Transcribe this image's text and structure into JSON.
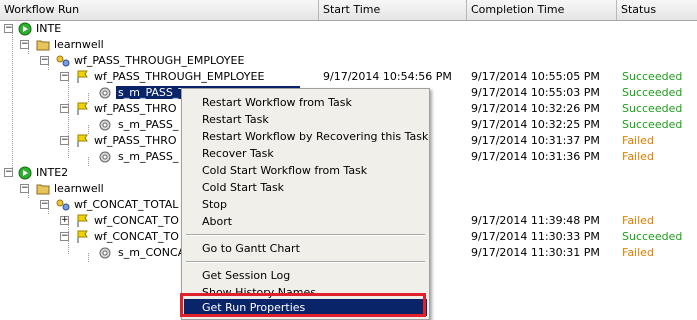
{
  "columns": [
    "Workflow Run",
    "Start Time",
    "Completion Time",
    "Status"
  ],
  "rows": [
    {
      "label": "INTE",
      "start": "",
      "end": "",
      "status": "",
      "statusType": ""
    },
    {
      "label": "learnwell",
      "start": "",
      "end": "",
      "status": "",
      "statusType": ""
    },
    {
      "label": "wf_PASS_THROUGH_EMPLOYEE",
      "start": "",
      "end": "",
      "status": "",
      "statusType": ""
    },
    {
      "label": "wf_PASS_THROUGH_EMPLOYEE",
      "start": "9/17/2014 10:54:56 PM",
      "end": "9/17/2014 10:55:05 PM",
      "status": "Succeeded",
      "statusType": "ok"
    },
    {
      "label": "s_m_PASS_THROUGH_EMPLOYEE",
      "start": "",
      "end": "9/17/2014 10:55:03 PM",
      "status": "Succeeded",
      "statusType": "ok"
    },
    {
      "label": "wf_PASS_THRO",
      "start": "",
      "end": "9/17/2014 10:32:26 PM",
      "status": "Succeeded",
      "statusType": "ok"
    },
    {
      "label": "s_m_PASS_",
      "start": "",
      "end": "9/17/2014 10:32:25 PM",
      "status": "Succeeded",
      "statusType": "ok"
    },
    {
      "label": "wf_PASS_THRO",
      "start": "",
      "end": "9/17/2014 10:31:37 PM",
      "status": "Failed",
      "statusType": "bad"
    },
    {
      "label": "s_m_PASS_",
      "start": "",
      "end": "9/17/2014 10:31:36 PM",
      "status": "Failed",
      "statusType": "bad"
    },
    {
      "label": "INTE2",
      "start": "",
      "end": "",
      "status": "",
      "statusType": ""
    },
    {
      "label": "learnwell",
      "start": "",
      "end": "",
      "status": "",
      "statusType": ""
    },
    {
      "label": "wf_CONCAT_TOTAL",
      "start": "",
      "end": "",
      "status": "",
      "statusType": ""
    },
    {
      "label": "wf_CONCAT_TO",
      "start": "",
      "end": "9/17/2014 11:39:48 PM",
      "status": "Failed",
      "statusType": "bad"
    },
    {
      "label": "wf_CONCAT_TO",
      "start": "",
      "end": "9/17/2014 11:30:33 PM",
      "status": "Succeeded",
      "statusType": "ok"
    },
    {
      "label": "s_m_CONCA",
      "start": "",
      "end": "9/17/2014 11:30:31 PM",
      "status": "Failed",
      "statusType": "bad"
    }
  ],
  "menu": {
    "items": [
      "Restart Workflow from Task",
      "Restart Task",
      "Restart Workflow by Recovering this Task",
      "Recover Task",
      "Cold Start Workflow from Task",
      "Cold Start Task",
      "Stop",
      "Abort",
      "Go to Gantt Chart",
      "Get Session Log",
      "Show History Names",
      "Get Run Properties"
    ],
    "highlighted": "Get Run Properties"
  },
  "colors": {
    "succeeded": "#1c9e1c",
    "failed": "#e87c00",
    "selection": "#0a246a",
    "highlight_box": "#e0202a"
  }
}
